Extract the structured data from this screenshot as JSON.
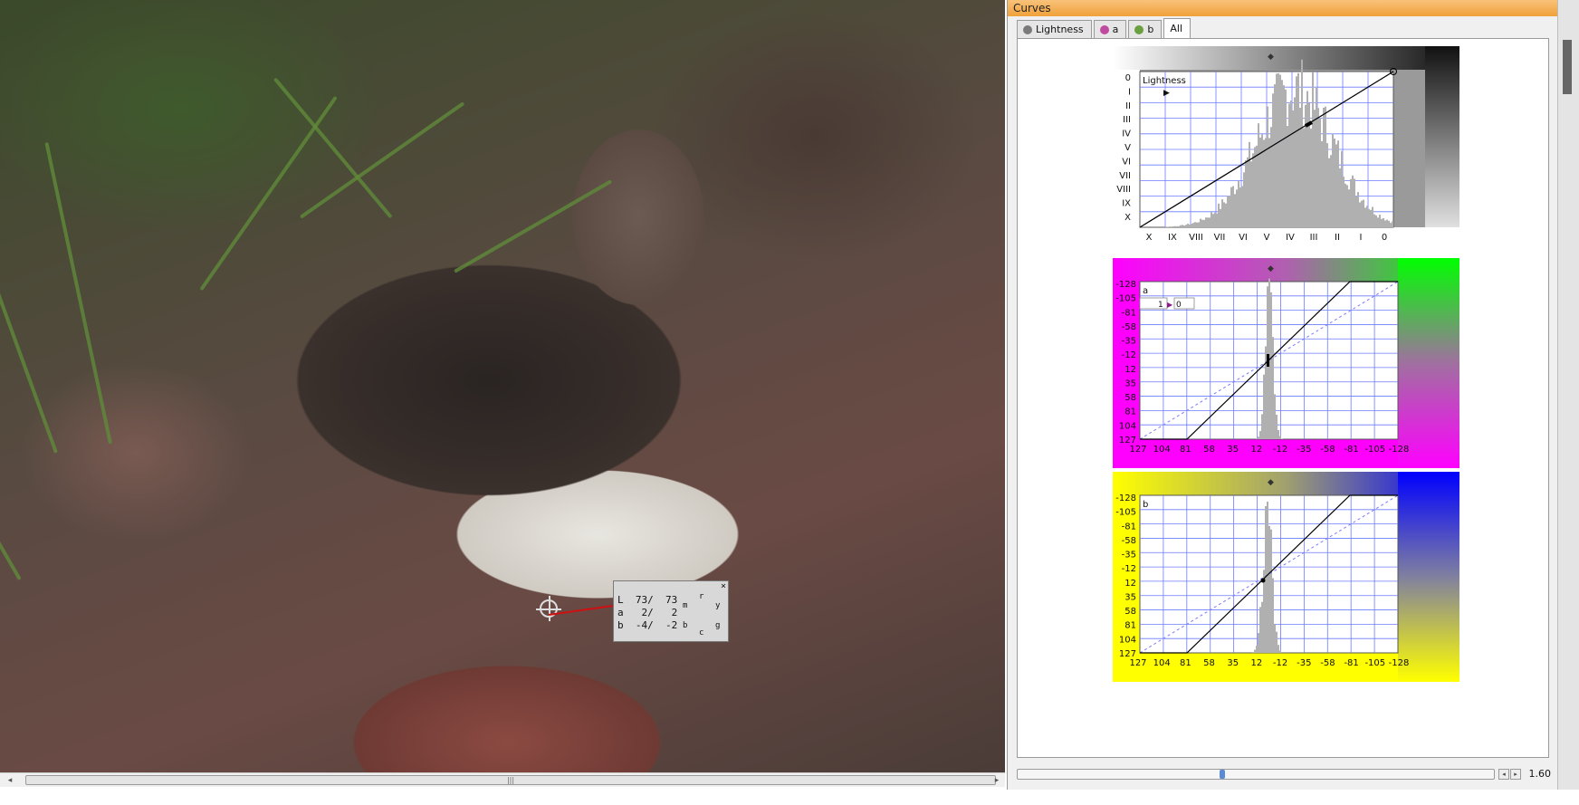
{
  "window": {
    "title": "Curves"
  },
  "tabs": [
    {
      "label": "Lightness",
      "active": false,
      "dot_color": "#7a7a7a"
    },
    {
      "label": "a",
      "active": false,
      "dot_color": "#c04aa0"
    },
    {
      "label": "b",
      "active": false,
      "dot_color": "#6aa040"
    },
    {
      "label": "All",
      "active": true,
      "dot_color": ""
    }
  ],
  "probe": {
    "close_glyph": "×",
    "rows": [
      {
        "channel": "L",
        "value1": "73/",
        "value2": "73"
      },
      {
        "channel": "a",
        "value1": "2/",
        "value2": "2"
      },
      {
        "channel": "b",
        "value1": "-4/",
        "value2": "-2"
      }
    ],
    "ring_labels": [
      "m",
      "r",
      "y",
      "b",
      "c",
      "g"
    ]
  },
  "curves": {
    "lightness": {
      "label": "Lightness",
      "y_ticks": [
        "0",
        "I",
        "II",
        "III",
        "IV",
        "V",
        "VI",
        "VII",
        "VIII",
        "IX",
        "X"
      ],
      "x_ticks": [
        "X",
        "IX",
        "VIII",
        "VII",
        "VI",
        "V",
        "IV",
        "III",
        "II",
        "I",
        "0"
      ]
    },
    "a": {
      "label": "a",
      "input_value": "1",
      "output_value": "0",
      "y_ticks": [
        "-128",
        "-105",
        "-81",
        "-58",
        "-35",
        "-12",
        "12",
        "35",
        "58",
        "81",
        "104",
        "127"
      ],
      "x_ticks": [
        "127",
        "104",
        "81",
        "58",
        "35",
        "12",
        "-12",
        "-35",
        "-58",
        "-81",
        "-105",
        "-128"
      ]
    },
    "b": {
      "label": "b",
      "y_ticks": [
        "-128",
        "-105",
        "-81",
        "-58",
        "-35",
        "-12",
        "12",
        "35",
        "58",
        "81",
        "104",
        "127"
      ],
      "x_ticks": [
        "127",
        "104",
        "81",
        "58",
        "35",
        "12",
        "-12",
        "-35",
        "-58",
        "-81",
        "-105",
        "-128"
      ]
    }
  },
  "zoom": {
    "value": "1.60"
  },
  "colors": {
    "grid": "#6b7bff",
    "a_panel_left": "#ff00ff",
    "a_panel_right": "#00ff00",
    "b_panel_left": "#ffff00",
    "b_panel_right": "#0000ff",
    "accent_title": "#f0a13a"
  },
  "icons": {
    "scroll_left": "◂",
    "scroll_right": "▸",
    "thumb_grip": "|||",
    "marker": "◆"
  }
}
